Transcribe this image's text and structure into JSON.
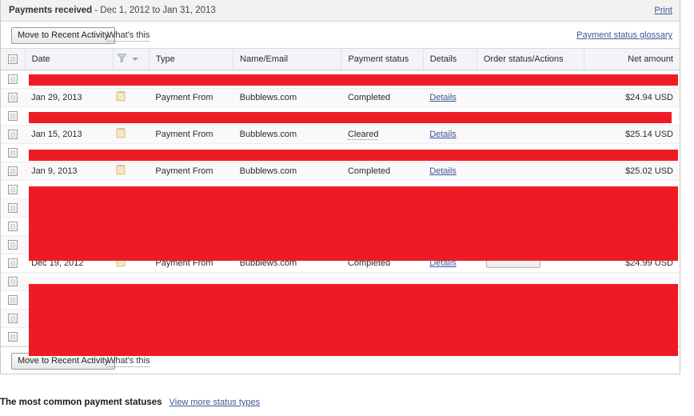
{
  "header": {
    "title": "Payments received",
    "date_range": "- Dec 1, 2012 to Jan 31, 2013",
    "print_label": "Print"
  },
  "toolbar_top": {
    "move_button_label": "Move to Recent Activity",
    "whats_this_label": "What's this",
    "glossary_link_label": "Payment status glossary"
  },
  "toolbar_bottom": {
    "move_button_label": "Move to Recent Activity",
    "whats_this_label": "What's this"
  },
  "table": {
    "columns": [
      {
        "key": "select",
        "label": ""
      },
      {
        "key": "date",
        "label": "Date"
      },
      {
        "key": "sort",
        "label": ""
      },
      {
        "key": "type",
        "label": "Type"
      },
      {
        "key": "name_email",
        "label": "Name/Email"
      },
      {
        "key": "payment_status",
        "label": "Payment status"
      },
      {
        "key": "details",
        "label": "Details"
      },
      {
        "key": "order_status",
        "label": "Order status/Actions"
      },
      {
        "key": "net_amount",
        "label": "Net amount"
      }
    ],
    "icons": {
      "sort_filter": "filter-icon",
      "row_type": "ledger-icon"
    },
    "rows": [
      {
        "redacted": true,
        "date": "",
        "type": "",
        "name_email": "",
        "payment_status": "",
        "details": "",
        "order_status": "",
        "net_amount": ""
      },
      {
        "redacted": false,
        "date": "Jan 29, 2013",
        "type": "Payment From",
        "name_email": "Bubblews.com",
        "payment_status": "Completed",
        "status_tooltip": false,
        "details": "Details",
        "order_status": "",
        "net_amount": "$24.94 USD"
      },
      {
        "redacted": true,
        "date": "",
        "type": "",
        "name_email": "",
        "payment_status": "",
        "details": "",
        "order_status": "",
        "net_amount": ""
      },
      {
        "redacted": false,
        "date": "Jan 15, 2013",
        "type": "Payment From",
        "name_email": "Bubblews.com",
        "payment_status": "Cleared",
        "status_tooltip": true,
        "details": "Details",
        "order_status": "",
        "net_amount": "$25.14 USD"
      },
      {
        "redacted": true,
        "date": "",
        "type": "",
        "name_email": "",
        "payment_status": "",
        "details": "",
        "order_status": "",
        "net_amount": ""
      },
      {
        "redacted": false,
        "date": "Jan 9, 2013",
        "type": "Payment From",
        "name_email": "Bubblews.com",
        "payment_status": "Completed",
        "status_tooltip": false,
        "details": "Details",
        "order_status": "",
        "net_amount": "$25.02 USD"
      },
      {
        "redacted": true,
        "date": "",
        "type": "",
        "name_email": "",
        "payment_status": "",
        "details": "",
        "order_status": "",
        "net_amount": ""
      },
      {
        "redacted": true,
        "date": "",
        "type": "",
        "name_email": "",
        "payment_status": "",
        "details": "",
        "order_status": "",
        "net_amount": ""
      },
      {
        "redacted": true,
        "date": "",
        "type": "",
        "name_email": "",
        "payment_status": "",
        "details": "",
        "order_status": "",
        "net_amount": ""
      },
      {
        "redacted": true,
        "date": "",
        "type": "",
        "name_email": "",
        "payment_status": "",
        "details": "",
        "order_status": "",
        "net_amount": ""
      },
      {
        "redacted": false,
        "date": "Dec 19, 2012",
        "type": "Payment From",
        "name_email": "Bubblews.com",
        "payment_status": "Completed",
        "status_tooltip": false,
        "details": "Details",
        "order_status": "",
        "net_amount": "$24.99 USD"
      },
      {
        "redacted": true,
        "date": "",
        "type": "",
        "name_email": "",
        "payment_status": "",
        "details": "",
        "order_status": "",
        "net_amount": ""
      },
      {
        "redacted": true,
        "date": "",
        "type": "",
        "name_email": "",
        "payment_status": "",
        "details": "",
        "order_status": "",
        "net_amount": ""
      },
      {
        "redacted": true,
        "date": "",
        "type": "",
        "name_email": "",
        "payment_status": "",
        "details": "",
        "order_status": "",
        "net_amount": ""
      },
      {
        "redacted": true,
        "date": "",
        "type": "",
        "name_email": "",
        "payment_status": "",
        "details": "",
        "order_status": "",
        "net_amount": ""
      }
    ]
  },
  "footer": {
    "caption": "The most common payment statuses",
    "view_more_label": "View more status types"
  },
  "colors": {
    "redaction": "#ed1c24",
    "link": "#3b5998",
    "header_bg": "#f2f4f7",
    "titlebar_bg": "#f2f2f2"
  }
}
